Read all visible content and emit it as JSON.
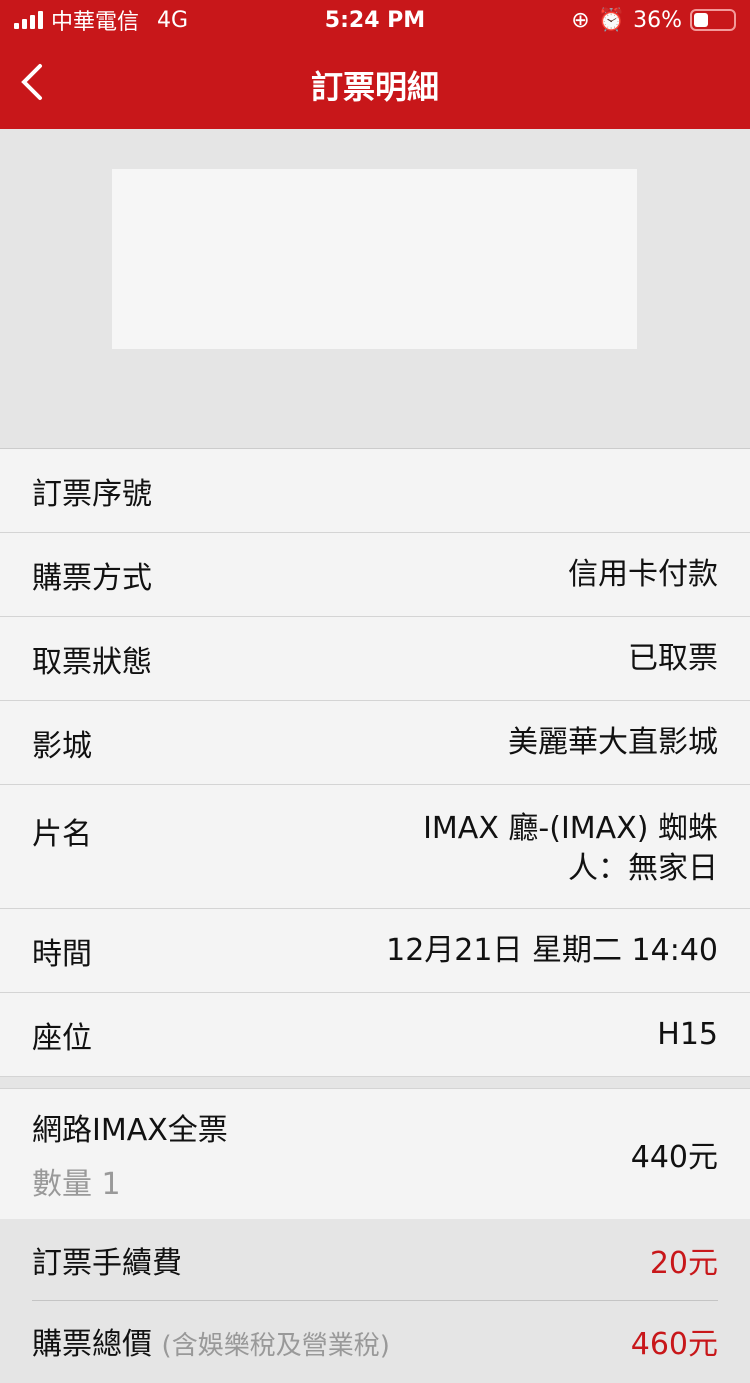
{
  "status": {
    "carrier": "中華電信",
    "network": "4G",
    "time": "5:24 PM",
    "battery": "36%",
    "battery_level": 0.36
  },
  "header": {
    "title": "訂票明細"
  },
  "details": [
    {
      "label": "訂票序號",
      "value": ""
    },
    {
      "label": "購票方式",
      "value": "信用卡付款"
    },
    {
      "label": "取票狀態",
      "value": "已取票"
    },
    {
      "label": "影城",
      "value": "美麗華大直影城"
    },
    {
      "label": "片名",
      "value": "IMAX 廳-(IMAX) 蜘蛛\n人：無家日"
    },
    {
      "label": "時間",
      "value": "12月21日 星期二 14:40"
    },
    {
      "label": "座位",
      "value": "H15"
    }
  ],
  "ticket": {
    "name": "網路IMAX全票",
    "qty_label": "數量",
    "qty": "1",
    "price": "440元"
  },
  "fee": {
    "label": "訂票手續費",
    "value": "20元"
  },
  "total": {
    "label": "購票總價",
    "note": "(含娛樂稅及營業稅)",
    "value": "460元"
  },
  "colors": {
    "brand": "#c8171a"
  }
}
